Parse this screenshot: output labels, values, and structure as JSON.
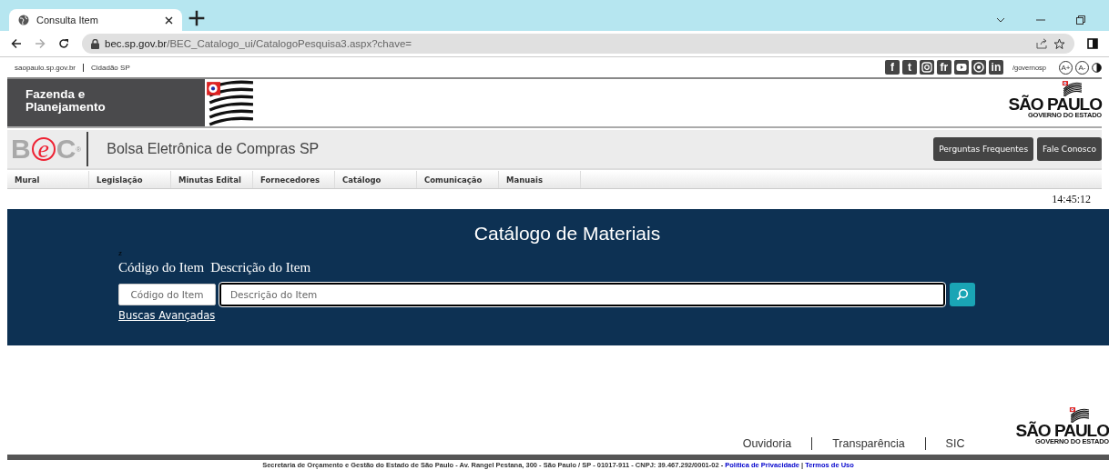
{
  "browser": {
    "tab": {
      "title": "Consulta Item",
      "selected": true
    },
    "url": {
      "host": "bec.sp.gov.br",
      "path": "/BEC_Catalogo_ui/CatalogoPesquisa3.aspx?chave="
    },
    "forward_disabled": true
  },
  "gov_bar": {
    "links": [
      "saopaulo.sp.gov.br",
      "Cidadão SP"
    ],
    "social": [
      {
        "kind": "letter",
        "label": "f"
      },
      {
        "kind": "letter",
        "label": "t"
      },
      {
        "kind": "camera"
      },
      {
        "kind": "letter",
        "label": "fr"
      },
      {
        "kind": "play"
      },
      {
        "kind": "target"
      },
      {
        "kind": "letter",
        "label": "in"
      }
    ],
    "handle": "/governosp",
    "font_buttons": [
      "A+",
      "A-"
    ]
  },
  "header": {
    "title_lines": [
      "Fazenda e",
      "Planejamento"
    ],
    "logo": {
      "title": "SÃO PAULO",
      "subtitle": "GOVERNO DO ESTADO"
    }
  },
  "bec_bar": {
    "logo_letters": [
      "B",
      "e",
      "C"
    ],
    "logo_mark": "®",
    "title": "Bolsa Eletrônica de Compras SP",
    "buttons": [
      "Perguntas Frequentes",
      "Fale Conosco"
    ]
  },
  "menu": [
    "Mural",
    "Legislação",
    "Minutas Edital",
    "Fornecedores",
    "Catálogo",
    "Comunicação",
    "Manuais"
  ],
  "clock": "14:45:12",
  "search_panel": {
    "title": "Catálogo de Materiais",
    "stray_mark": "z",
    "code_label": "Código do Item",
    "description_label": "Descrição do Item",
    "code_field": {
      "placeholder": "Código do Item"
    },
    "description_field": {
      "placeholder": "Descrição do Item"
    },
    "advanced_link": "Buscas Avançadas"
  },
  "footer": {
    "links": [
      "Ouvidoria",
      "Transparência",
      "SIC"
    ],
    "logo": {
      "title": "SÃO PAULO",
      "subtitle": "GOVERNO DO ESTADO"
    },
    "address": "Secretaria de Orçamento e Gestão do Estado de São Paulo - Av. Rangel Pestana, 300 - São Paulo / SP - 01017-911 - CNPJ: 39.467.292/0001-02 - ",
    "legal_links": [
      "Política de Privacidade",
      "Termos de Uso"
    ],
    "legal_separator": " | "
  }
}
